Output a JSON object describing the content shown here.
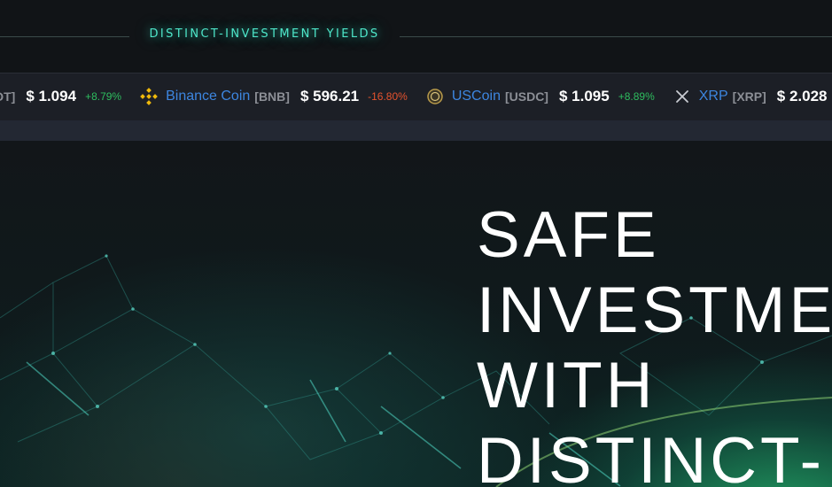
{
  "header": {
    "tagline": "DISTINCT-INVESTMENT YIELDS"
  },
  "ticker": {
    "items": [
      {
        "name": "",
        "symbol": "DT]",
        "price": "$ 1.094",
        "change": "+8.79%",
        "direction": "up",
        "icon": "none"
      },
      {
        "name": "Binance Coin",
        "symbol": "[BNB]",
        "price": "$ 596.21",
        "change": "-16.80%",
        "direction": "down",
        "icon": "binance-icon"
      },
      {
        "name": "USCoin",
        "symbol": "[USDC]",
        "price": "$ 1.095",
        "change": "+8.89%",
        "direction": "up",
        "icon": "usdc-icon"
      },
      {
        "name": "XRP",
        "symbol": "[XRP]",
        "price": "$ 2.028",
        "change": "",
        "direction": "up",
        "icon": "xrp-icon"
      }
    ]
  },
  "hero": {
    "headline_lines": [
      "SAFE",
      "INVESTME",
      "WITH",
      "DISTINCT-"
    ]
  },
  "colors": {
    "accent": "#4ee6c9",
    "coin_name": "#3d86e0",
    "up": "#2ebd5f",
    "down": "#e6532e"
  }
}
